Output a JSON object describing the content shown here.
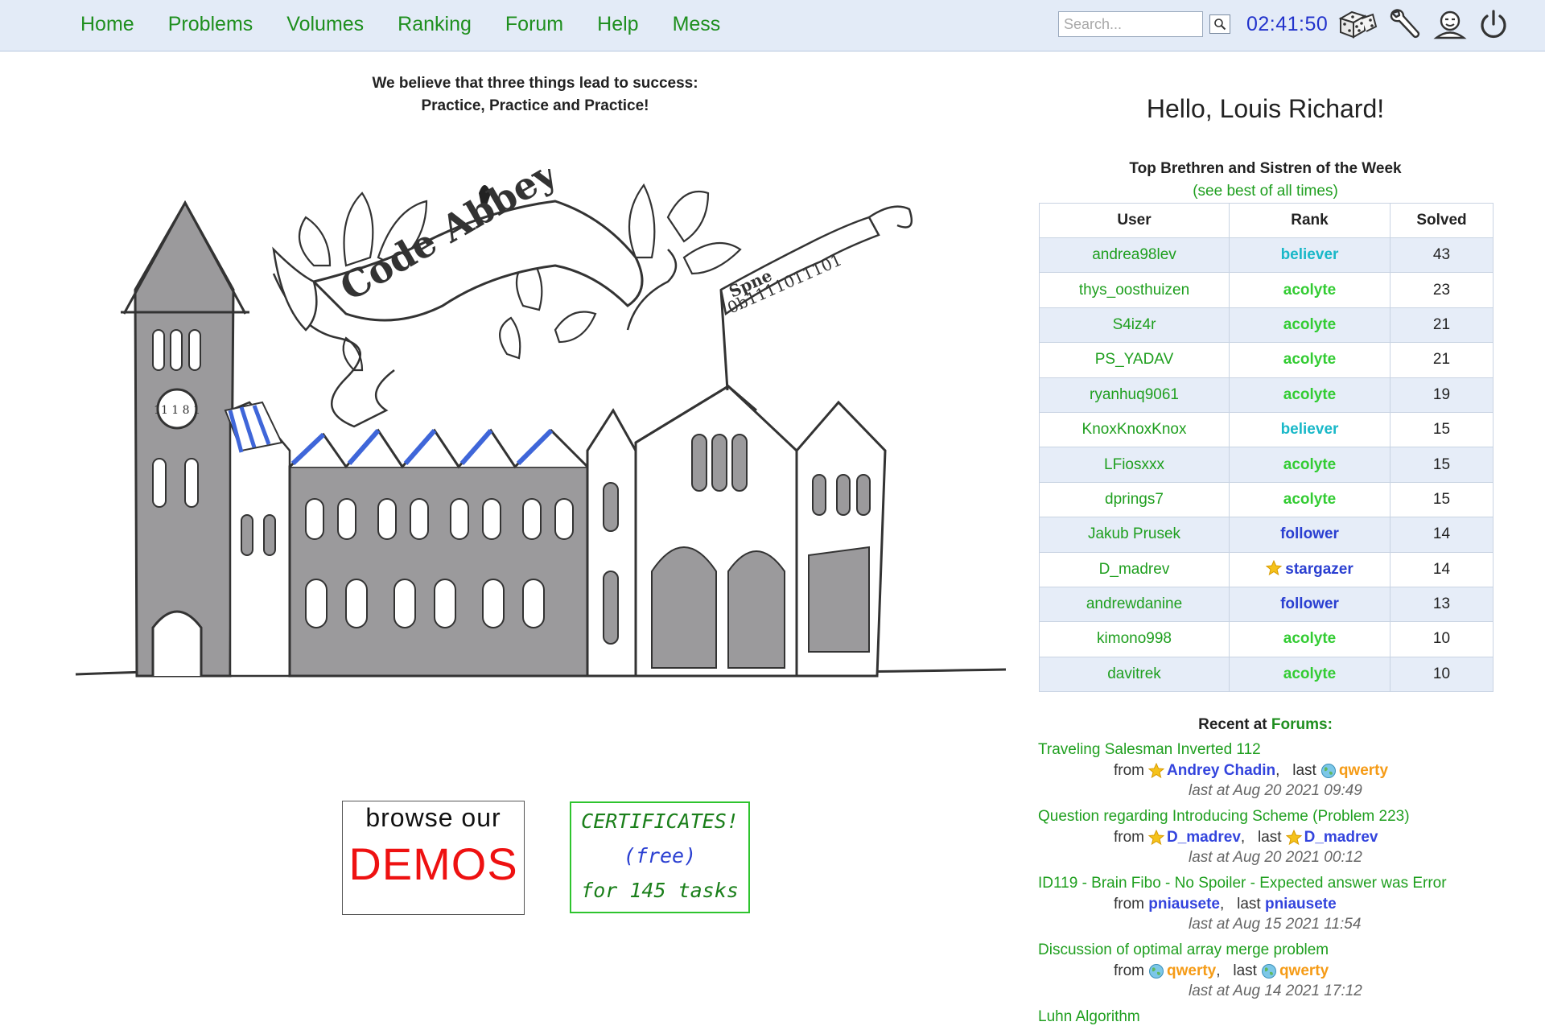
{
  "nav": {
    "items": [
      "Home",
      "Problems",
      "Volumes",
      "Ranking",
      "Forum",
      "Help",
      "Mess"
    ]
  },
  "search": {
    "placeholder": "Search..."
  },
  "clock": "02:41:50",
  "motto": {
    "line1": "We believe that three things lead to success:",
    "line2": "Practice, Practice and Practice!"
  },
  "drawing": {
    "banner_text": "Code Abbey",
    "flag_text": "0b1111011101",
    "flag_word": "Spne",
    "clock_text": "11 1 8 1"
  },
  "demos": {
    "line1": "browse our",
    "line2": "DEMOS"
  },
  "certificates": {
    "line1": "CERTIFICATES!",
    "line2": "(free)",
    "line3": "for 145 tasks"
  },
  "greeting": "Hello, Louis Richard!",
  "top_week": {
    "title": "Top Brethren and Sistren of the Week",
    "link": "(see best of all times)",
    "headers": [
      "User",
      "Rank",
      "Solved"
    ],
    "rows": [
      {
        "user": "andrea98lev",
        "rank": "believer",
        "solved": "43"
      },
      {
        "user": "thys_oosthuizen",
        "rank": "acolyte",
        "solved": "23"
      },
      {
        "user": "S4iz4r",
        "rank": "acolyte",
        "solved": "21"
      },
      {
        "user": "PS_YADAV",
        "rank": "acolyte",
        "solved": "21"
      },
      {
        "user": "ryanhuq9061",
        "rank": "acolyte",
        "solved": "19"
      },
      {
        "user": "KnoxKnoxKnox",
        "rank": "believer",
        "solved": "15"
      },
      {
        "user": "LFiosxxx",
        "rank": "acolyte",
        "solved": "15"
      },
      {
        "user": "dprings7",
        "rank": "acolyte",
        "solved": "15"
      },
      {
        "user": "Jakub Prusek",
        "rank": "follower",
        "solved": "14"
      },
      {
        "user": "D_madrev",
        "rank": "stargazer",
        "solved": "14",
        "star": true
      },
      {
        "user": "andrewdanine",
        "rank": "follower",
        "solved": "13"
      },
      {
        "user": "kimono998",
        "rank": "acolyte",
        "solved": "10"
      },
      {
        "user": "davitrek",
        "rank": "acolyte",
        "solved": "10"
      }
    ]
  },
  "rank_colors": {
    "believer": "#19b8c8",
    "acolyte": "#33cc33",
    "follower": "#2a3fd1",
    "stargazer": "#2a3fd1",
    "orange_user": "#f59b16",
    "blue_user": "#3344dd"
  },
  "forums": {
    "label_prefix": "Recent at",
    "label_link": "Forums:",
    "from_word": "from",
    "last_word": "last",
    "topics": [
      {
        "title": "Traveling Salesman Inverted 112",
        "from": "Andrey Chadin",
        "from_icon": "star",
        "from_color": "blue",
        "last": "qwerty",
        "last_icon": "globe",
        "last_color": "orange",
        "time": "last at Aug 20 2021 09:49"
      },
      {
        "title": "Question regarding Introducing Scheme (Problem 223)",
        "from": "D_madrev",
        "from_icon": "star",
        "from_color": "blue",
        "last": "D_madrev",
        "last_icon": "star",
        "last_color": "blue",
        "time": "last at Aug 20 2021 00:12"
      },
      {
        "title": "ID119 - Brain Fibo - No Spoiler - Expected answer was Error",
        "from": "pniausete",
        "from_icon": "",
        "from_color": "blue",
        "last": "pniausete",
        "last_icon": "",
        "last_color": "blue",
        "time": "last at Aug 15 2021 11:54"
      },
      {
        "title": "Discussion of optimal array merge problem",
        "from": "qwerty",
        "from_icon": "globe",
        "from_color": "orange",
        "last": "qwerty",
        "last_icon": "globe",
        "last_color": "orange",
        "time": "last at Aug 14 2021 17:12"
      },
      {
        "title": "Luhn Algorithm",
        "from": "",
        "from_icon": "",
        "from_color": "",
        "last": "",
        "last_icon": "",
        "last_color": "",
        "time": ""
      }
    ]
  }
}
